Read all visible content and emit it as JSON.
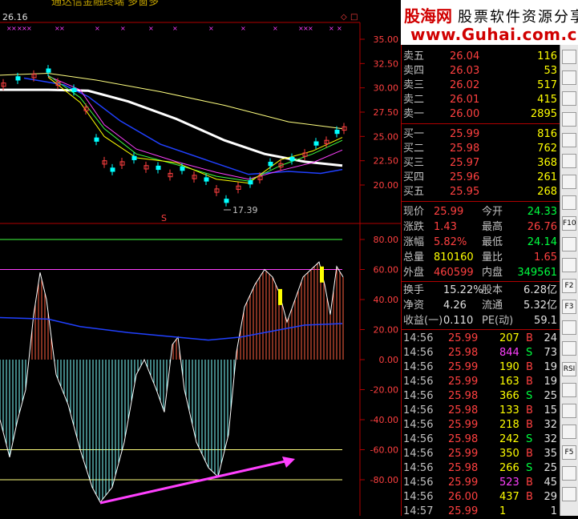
{
  "header": {
    "title_fragment": "通达信金融终端  多窗多",
    "price_label": "26.16"
  },
  "banner": {
    "site_cn": "股海网",
    "slogan": "股票软件资源分享",
    "url": "www.Guhai.com.cn"
  },
  "main_chart": {
    "y_ticks": [
      "35.00",
      "32.50",
      "30.00",
      "27.50",
      "25.00",
      "22.50",
      "20.00"
    ],
    "low_label": "17.39",
    "marker": "S"
  },
  "indicator": {
    "y_ticks": [
      "80.00",
      "60.00",
      "40.00",
      "20.00",
      "0.00",
      "-20.00",
      "-40.00",
      "-60.00",
      "-80.00"
    ]
  },
  "order_book": {
    "asks": [
      {
        "label": "卖五",
        "price": "26.04",
        "vol": "116"
      },
      {
        "label": "卖四",
        "price": "26.03",
        "vol": "53"
      },
      {
        "label": "卖三",
        "price": "26.02",
        "vol": "517"
      },
      {
        "label": "卖二",
        "price": "26.01",
        "vol": "415"
      },
      {
        "label": "卖一",
        "price": "26.00",
        "vol": "2895"
      }
    ],
    "bids": [
      {
        "label": "买一",
        "price": "25.99",
        "vol": "816"
      },
      {
        "label": "买二",
        "price": "25.98",
        "vol": "762"
      },
      {
        "label": "买三",
        "price": "25.97",
        "vol": "368"
      },
      {
        "label": "买四",
        "price": "25.96",
        "vol": "261"
      },
      {
        "label": "买五",
        "price": "25.95",
        "vol": "268"
      }
    ]
  },
  "stats": {
    "rows": [
      {
        "l1": "现价",
        "v1": "25.99",
        "l2": "今开",
        "v2": "24.33"
      },
      {
        "l1": "涨跌",
        "v1": "1.43",
        "l2": "最高",
        "v2": "26.76"
      },
      {
        "l1": "涨幅",
        "v1": "5.82%",
        "l2": "最低",
        "v2": "24.14"
      },
      {
        "l1": "总量",
        "v1": "810160",
        "l2": "量比",
        "v2": "1.65"
      },
      {
        "l1": "外盘",
        "v1": "460599",
        "l2": "内盘",
        "v2": "349561"
      }
    ],
    "rows2": [
      {
        "l1": "换手",
        "v1": "15.22%",
        "l2": "股本",
        "v2": "6.28亿"
      },
      {
        "l1": "净资",
        "v1": "4.26",
        "l2": "流通",
        "v2": "5.32亿"
      },
      {
        "l1": "收益(一)",
        "v1": "0.110",
        "l2": "PE(动)",
        "v2": "59.1"
      }
    ]
  },
  "ticks": [
    {
      "time": "14:56",
      "price": "25.99",
      "vol": "207",
      "side": "B",
      "n": "24"
    },
    {
      "time": "14:56",
      "price": "25.98",
      "vol": "844",
      "side": "S",
      "n": "73"
    },
    {
      "time": "14:56",
      "price": "25.99",
      "vol": "190",
      "side": "B",
      "n": "19"
    },
    {
      "time": "14:56",
      "price": "25.99",
      "vol": "163",
      "side": "B",
      "n": "19"
    },
    {
      "time": "14:56",
      "price": "25.98",
      "vol": "366",
      "side": "S",
      "n": "25"
    },
    {
      "time": "14:56",
      "price": "25.98",
      "vol": "133",
      "side": "B",
      "n": "15"
    },
    {
      "time": "14:56",
      "price": "25.99",
      "vol": "218",
      "side": "B",
      "n": "32"
    },
    {
      "time": "14:56",
      "price": "25.98",
      "vol": "242",
      "side": "S",
      "n": "32"
    },
    {
      "time": "14:56",
      "price": "25.99",
      "vol": "350",
      "side": "B",
      "n": "35"
    },
    {
      "time": "14:56",
      "price": "25.98",
      "vol": "266",
      "side": "S",
      "n": "25"
    },
    {
      "time": "14:56",
      "price": "25.99",
      "vol": "523",
      "side": "B",
      "n": "45"
    },
    {
      "time": "14:56",
      "price": "26.00",
      "vol": "437",
      "side": "B",
      "n": "29"
    },
    {
      "time": "14:57",
      "price": "25.99",
      "vol": "1",
      "side": "",
      "n": "1"
    }
  ],
  "colors": {
    "up": "#ff4040",
    "down": "#00ff40",
    "accent": "#ffff00",
    "grid": "#b00000"
  }
}
